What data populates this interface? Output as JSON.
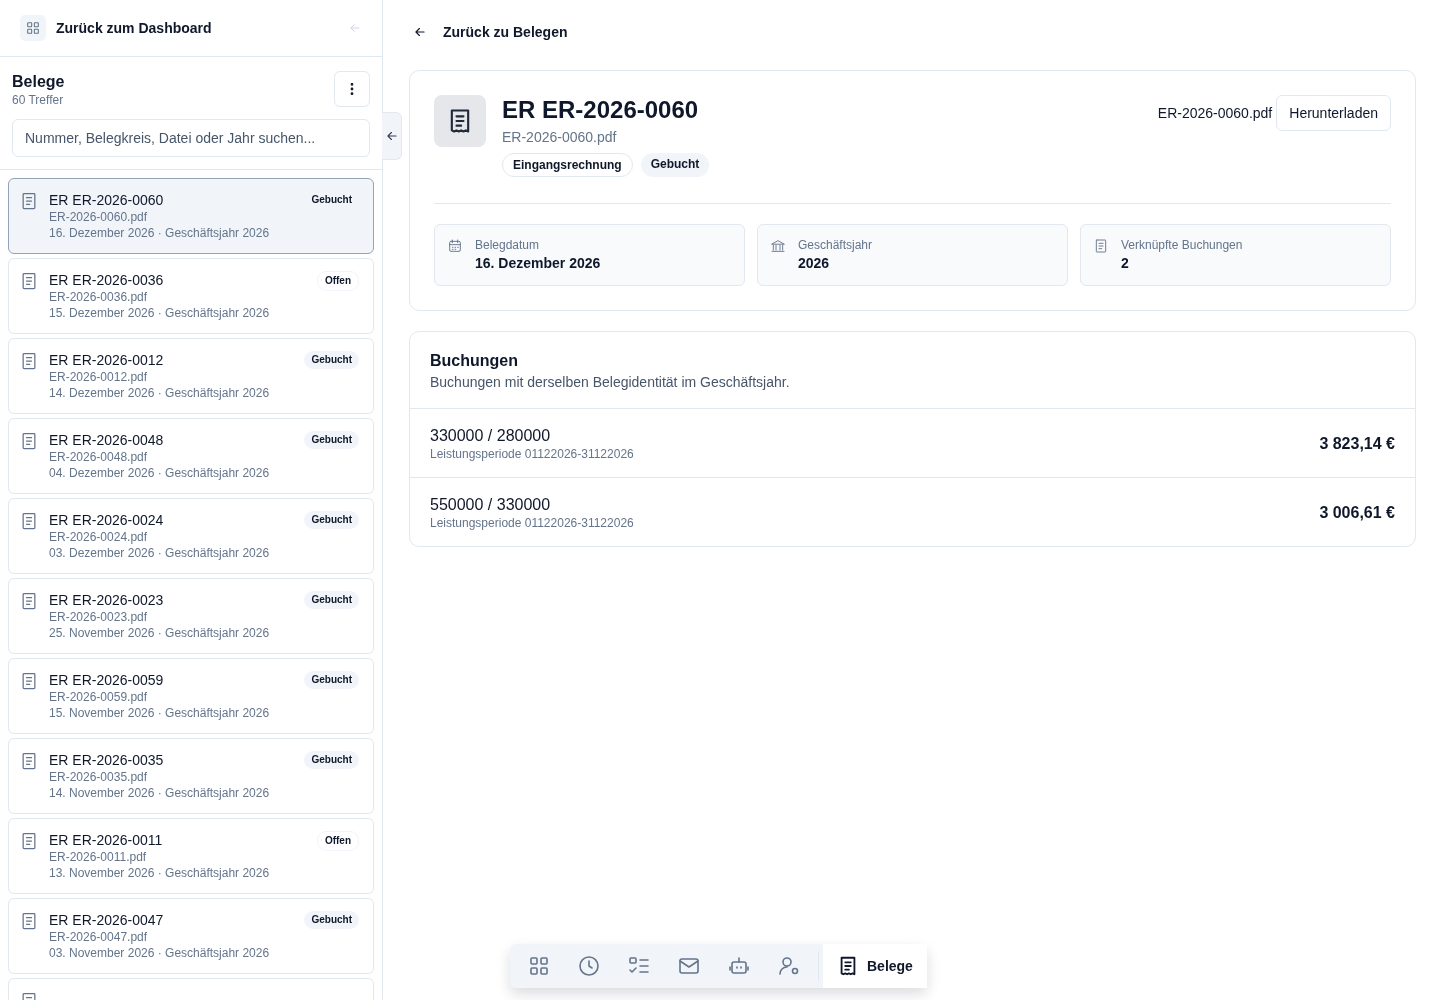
{
  "sidebar": {
    "back_link": "Zurück zum Dashboard",
    "title": "Belege",
    "count": "60 Treffer",
    "search": {
      "placeholder": "Nummer, Belegkreis, Datei oder Jahr suchen..."
    },
    "items": [
      {
        "title": "ER ER-2026-0060",
        "file": "ER-2026-0060.pdf",
        "meta": "16. Dezember 2026 · Geschäftsjahr 2026",
        "status": "Gebucht",
        "kind": "booked",
        "selected": true
      },
      {
        "title": "ER ER-2026-0036",
        "file": "ER-2026-0036.pdf",
        "meta": "15. Dezember 2026 · Geschäftsjahr 2026",
        "status": "Offen",
        "kind": "open",
        "selected": false
      },
      {
        "title": "ER ER-2026-0012",
        "file": "ER-2026-0012.pdf",
        "meta": "14. Dezember 2026 · Geschäftsjahr 2026",
        "status": "Gebucht",
        "kind": "booked",
        "selected": false
      },
      {
        "title": "ER ER-2026-0048",
        "file": "ER-2026-0048.pdf",
        "meta": "04. Dezember 2026 · Geschäftsjahr 2026",
        "status": "Gebucht",
        "kind": "booked",
        "selected": false
      },
      {
        "title": "ER ER-2026-0024",
        "file": "ER-2026-0024.pdf",
        "meta": "03. Dezember 2026 · Geschäftsjahr 2026",
        "status": "Gebucht",
        "kind": "booked",
        "selected": false
      },
      {
        "title": "ER ER-2026-0023",
        "file": "ER-2026-0023.pdf",
        "meta": "25. November 2026 · Geschäftsjahr 2026",
        "status": "Gebucht",
        "kind": "booked",
        "selected": false
      },
      {
        "title": "ER ER-2026-0059",
        "file": "ER-2026-0059.pdf",
        "meta": "15. November 2026 · Geschäftsjahr 2026",
        "status": "Gebucht",
        "kind": "booked",
        "selected": false
      },
      {
        "title": "ER ER-2026-0035",
        "file": "ER-2026-0035.pdf",
        "meta": "14. November 2026 · Geschäftsjahr 2026",
        "status": "Gebucht",
        "kind": "booked",
        "selected": false
      },
      {
        "title": "ER ER-2026-0011",
        "file": "ER-2026-0011.pdf",
        "meta": "13. November 2026 · Geschäftsjahr 2026",
        "status": "Offen",
        "kind": "open",
        "selected": false
      },
      {
        "title": "ER ER-2026-0047",
        "file": "ER-2026-0047.pdf",
        "meta": "03. November 2026 · Geschäftsjahr 2026",
        "status": "Gebucht",
        "kind": "booked",
        "selected": false
      },
      {
        "selected": false
      }
    ]
  },
  "back_link": "Zurück zu Belegen",
  "document": {
    "title": "ER ER-2026-0060",
    "file": "ER-2026-0060.pdf",
    "tags": [
      {
        "label": "Eingangsrechnung",
        "kind": "outline"
      },
      {
        "label": "Gebucht",
        "kind": "filled"
      }
    ],
    "file_name": "ER-2026-0060.pdf",
    "download_button": "Herunterladen",
    "facts": [
      {
        "kind": "calendar",
        "label": "Belegdatum",
        "value": "16. Dezember 2026"
      },
      {
        "kind": "bank",
        "label": "Geschäftsjahr",
        "value": "2026"
      },
      {
        "kind": "document",
        "label": "Verknüpfte Buchungen",
        "value": "2"
      }
    ]
  },
  "bookings": {
    "title": "Buchungen",
    "subtitle": "Buchungen mit derselben Belegidentität im Geschäftsjahr.",
    "rows": [
      {
        "accounts": "330000 / 280000",
        "period": "Leistungsperiode 01122026-31122026",
        "amount": "3 823,14 €"
      },
      {
        "accounts": "550000 / 330000",
        "period": "Leistungsperiode 01122026-31122026",
        "amount": "3 006,61 €"
      }
    ]
  },
  "dock": [
    {
      "kind": "grid",
      "selected": false
    },
    {
      "kind": "clock",
      "selected": false
    },
    {
      "kind": "checklist",
      "selected": false
    },
    {
      "kind": "mail",
      "selected": false
    },
    {
      "kind": "robot",
      "selected": false
    },
    {
      "kind": "user-settings",
      "selected": false
    },
    {
      "kind": "receipt",
      "label": "Belege",
      "selected": true
    }
  ]
}
